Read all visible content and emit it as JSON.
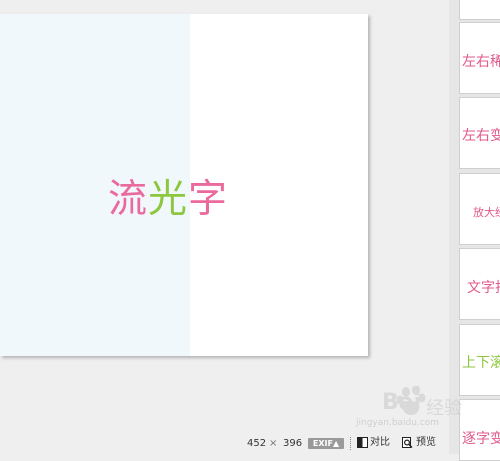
{
  "canvas": {
    "text": [
      {
        "char": "流",
        "color": "#ea6a9e"
      },
      {
        "char": "光",
        "color": "#8dc63f"
      },
      {
        "char": "字",
        "color": "#ea6a9e"
      }
    ]
  },
  "thumbnails": [
    {
      "label": "",
      "color": "#e05a8a"
    },
    {
      "label": "左右稀",
      "color": "#e05a8a"
    },
    {
      "label": "左右变",
      "color": "#e05a8a"
    },
    {
      "label": "放大经",
      "color": "#e05a8a"
    },
    {
      "label": "文字抖",
      "color": "#e05a8a"
    },
    {
      "label": "上下滚",
      "color": "#8dc63f"
    },
    {
      "label": "逐字变",
      "color": "#e05a8a"
    }
  ],
  "status": {
    "width": "452",
    "times": "×",
    "height": "396",
    "exif": "EXIF▲",
    "compare_label": "对比",
    "preview_label": "预览"
  },
  "watermark": {
    "brand": "Bai",
    "suffix": "经验",
    "url": "jingyan.baidu.com"
  }
}
